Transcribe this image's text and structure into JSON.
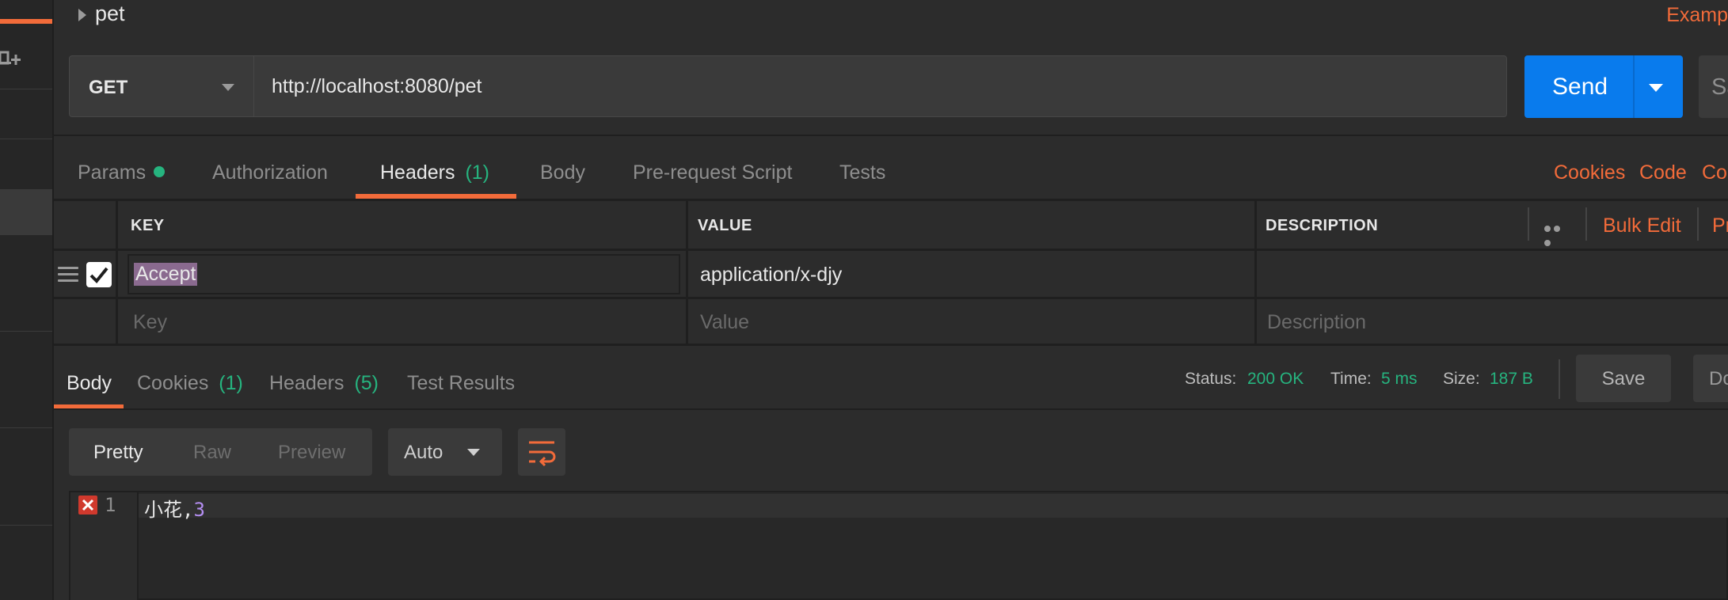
{
  "request": {
    "name": "pet",
    "examples_label": "Examp",
    "method": "GET",
    "url": "http://localhost:8080/pet",
    "send_label": "Send",
    "save_label": "Sa"
  },
  "request_tabs": {
    "params": "Params",
    "authorization": "Authorization",
    "headers": "Headers",
    "headers_count": "(1)",
    "body": "Body",
    "prerequest": "Pre-request Script",
    "tests": "Tests"
  },
  "request_links": {
    "cookies": "Cookies",
    "code": "Code",
    "comments": "Cor"
  },
  "headers_table": {
    "columns": {
      "key": "KEY",
      "value": "VALUE",
      "description": "DESCRIPTION"
    },
    "bulk_edit": "Bulk Edit",
    "presets": "Pr",
    "rows": [
      {
        "key": "Accept",
        "value": "application/x-djy",
        "description": "",
        "enabled": true
      }
    ],
    "placeholders": {
      "key": "Key",
      "value": "Value",
      "description": "Description"
    }
  },
  "response_tabs": {
    "body": "Body",
    "cookies": "Cookies",
    "cookies_count": "(1)",
    "headers": "Headers",
    "headers_count": "(5)",
    "test_results": "Test Results"
  },
  "response_status": {
    "status_label": "Status:",
    "status_value": "200 OK",
    "time_label": "Time:",
    "time_value": "5 ms",
    "size_label": "Size:",
    "size_value": "187 B",
    "save_label": "Save",
    "download_label": "Do"
  },
  "body_view": {
    "pretty": "Pretty",
    "raw": "Raw",
    "preview": "Preview",
    "format": "Auto"
  },
  "editor": {
    "line_number": "1",
    "text": "小花,",
    "number": "3"
  },
  "colors": {
    "accent": "#f26b3a",
    "primary": "#097bed",
    "success": "#26b47f",
    "error": "#d0392d"
  }
}
